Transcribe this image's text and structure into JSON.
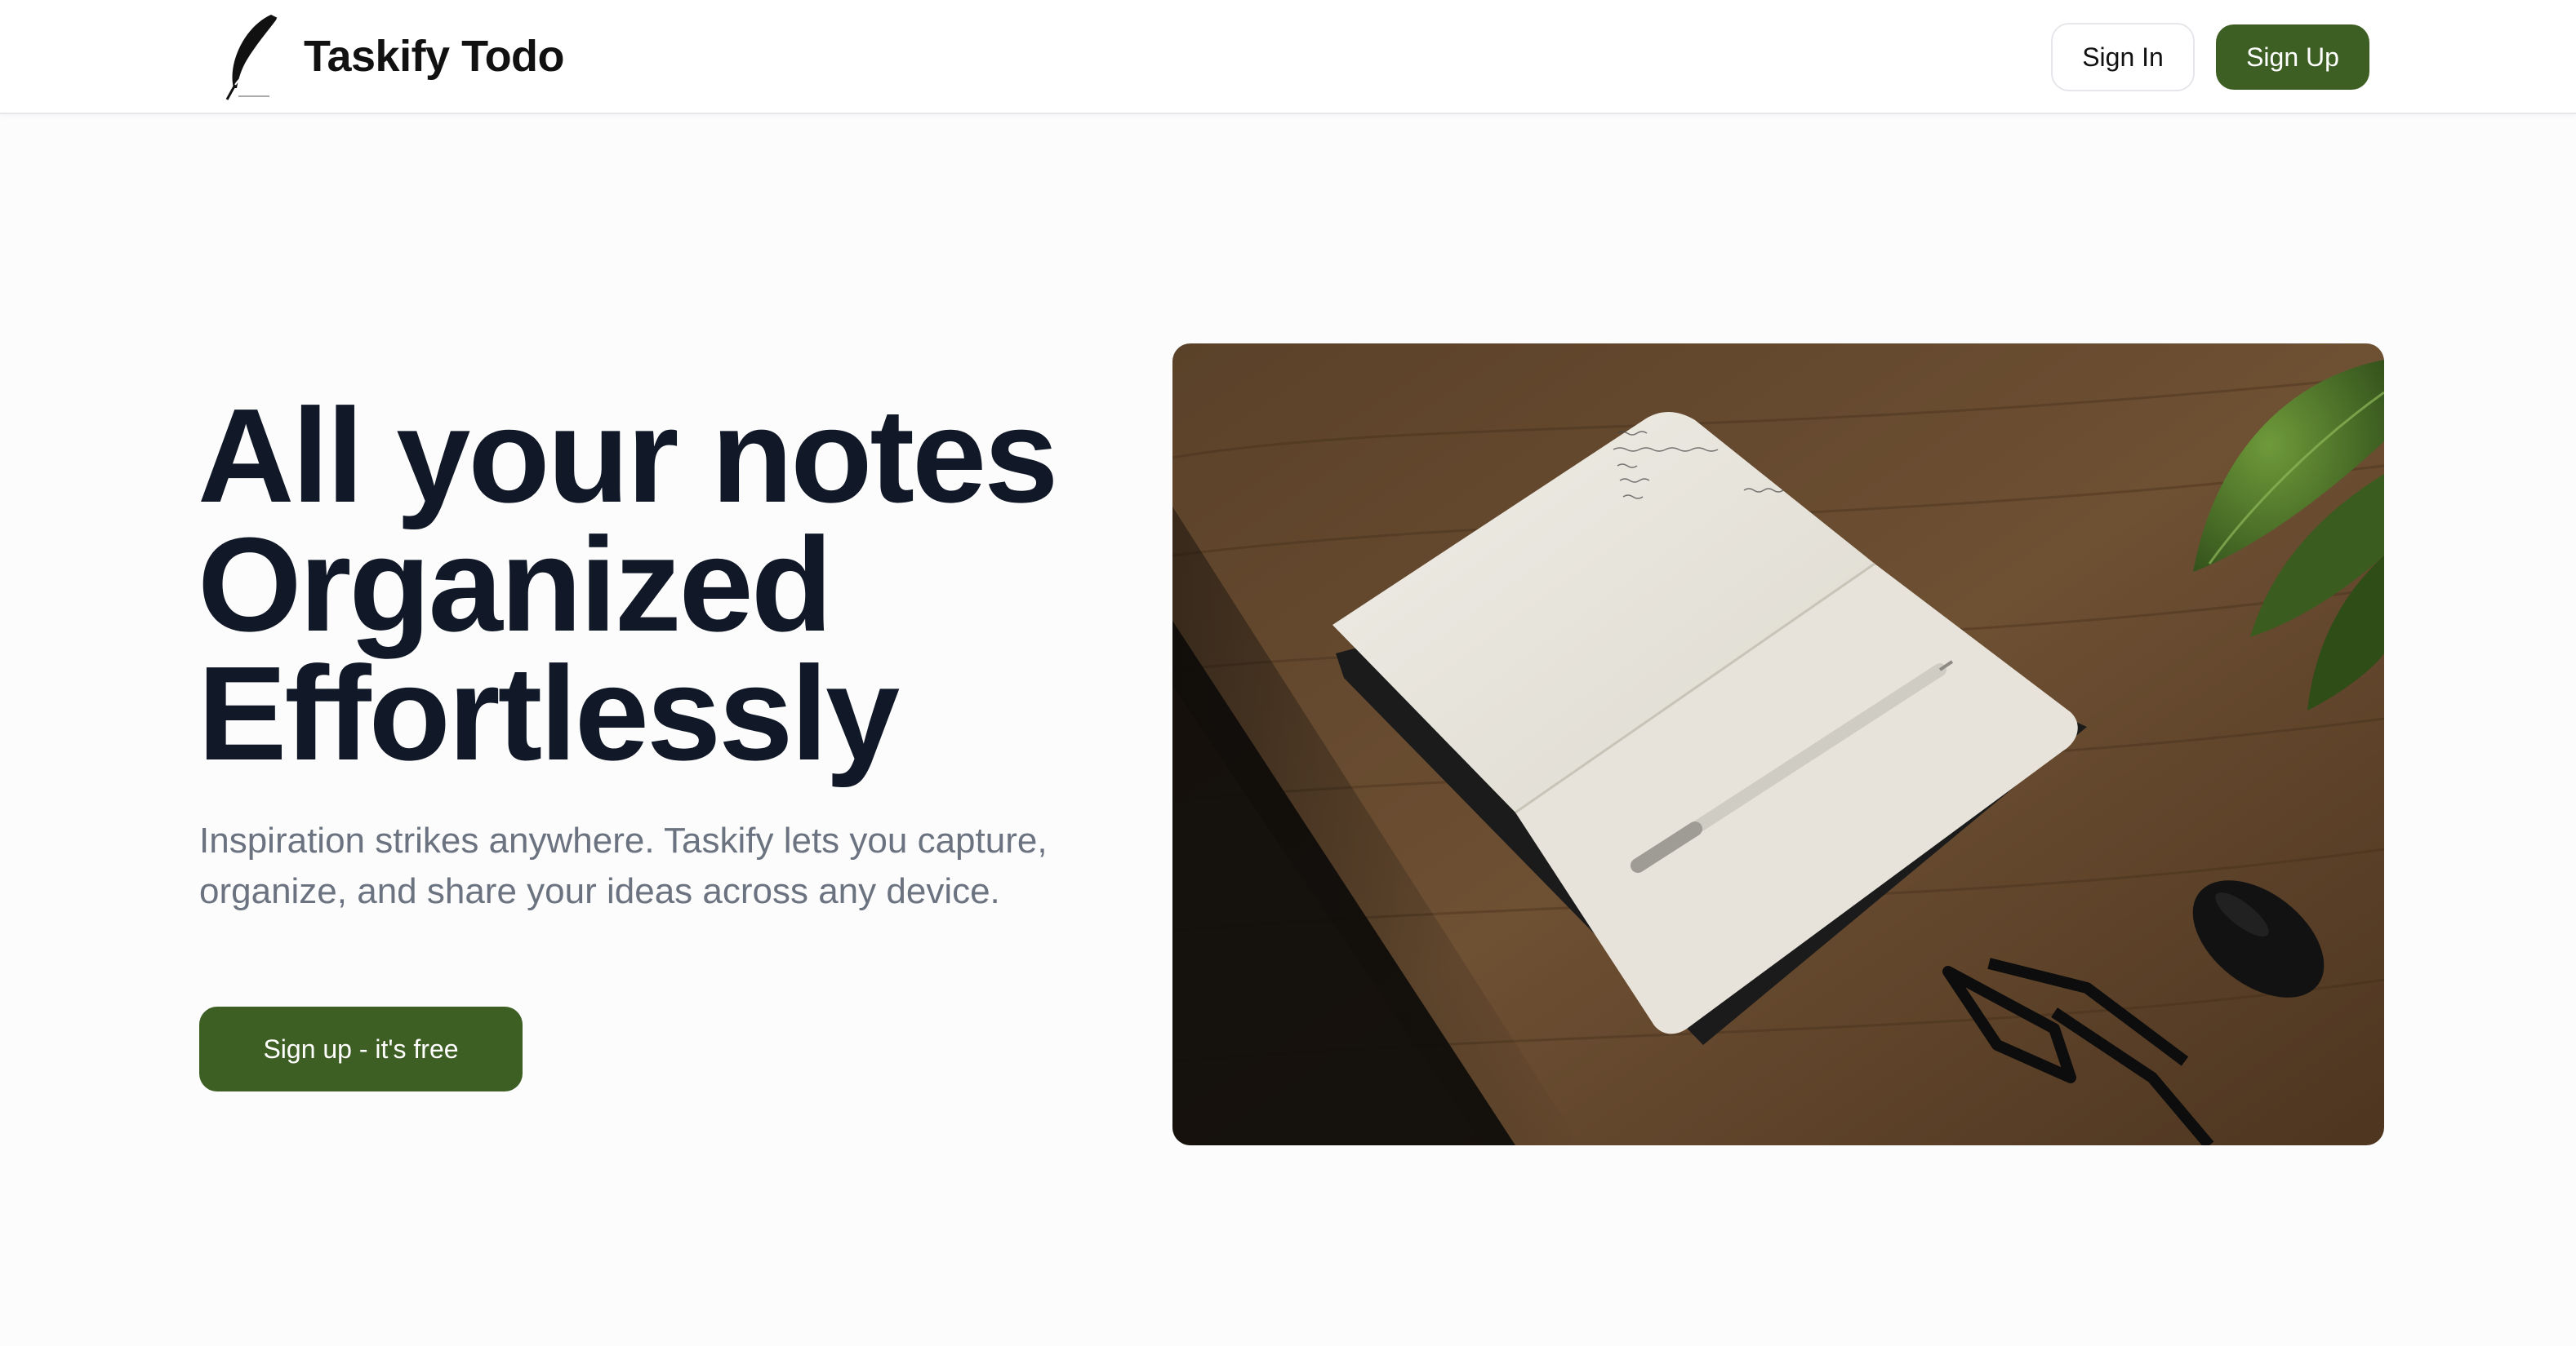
{
  "header": {
    "brand_name": "Taskify Todo",
    "logo_icon": "feather-quill-icon",
    "signin_label": "Sign In",
    "signup_label": "Sign Up"
  },
  "hero": {
    "headline_lines": [
      "All your notes",
      "Organized",
      "Effortlessly"
    ],
    "subtitle": "Inspiration strikes anywhere. Taskify lets you capture, organize, and share your ideas across any device.",
    "cta_label": "Sign up - it's free",
    "image": "photo of an open notebook with a pen on a wooden desk, glasses, earbuds case and a plant"
  },
  "colors": {
    "accent": "#3e5f24",
    "headline": "#111827",
    "subtitle": "#6b7280",
    "page_bg": "#fcfcfc"
  }
}
